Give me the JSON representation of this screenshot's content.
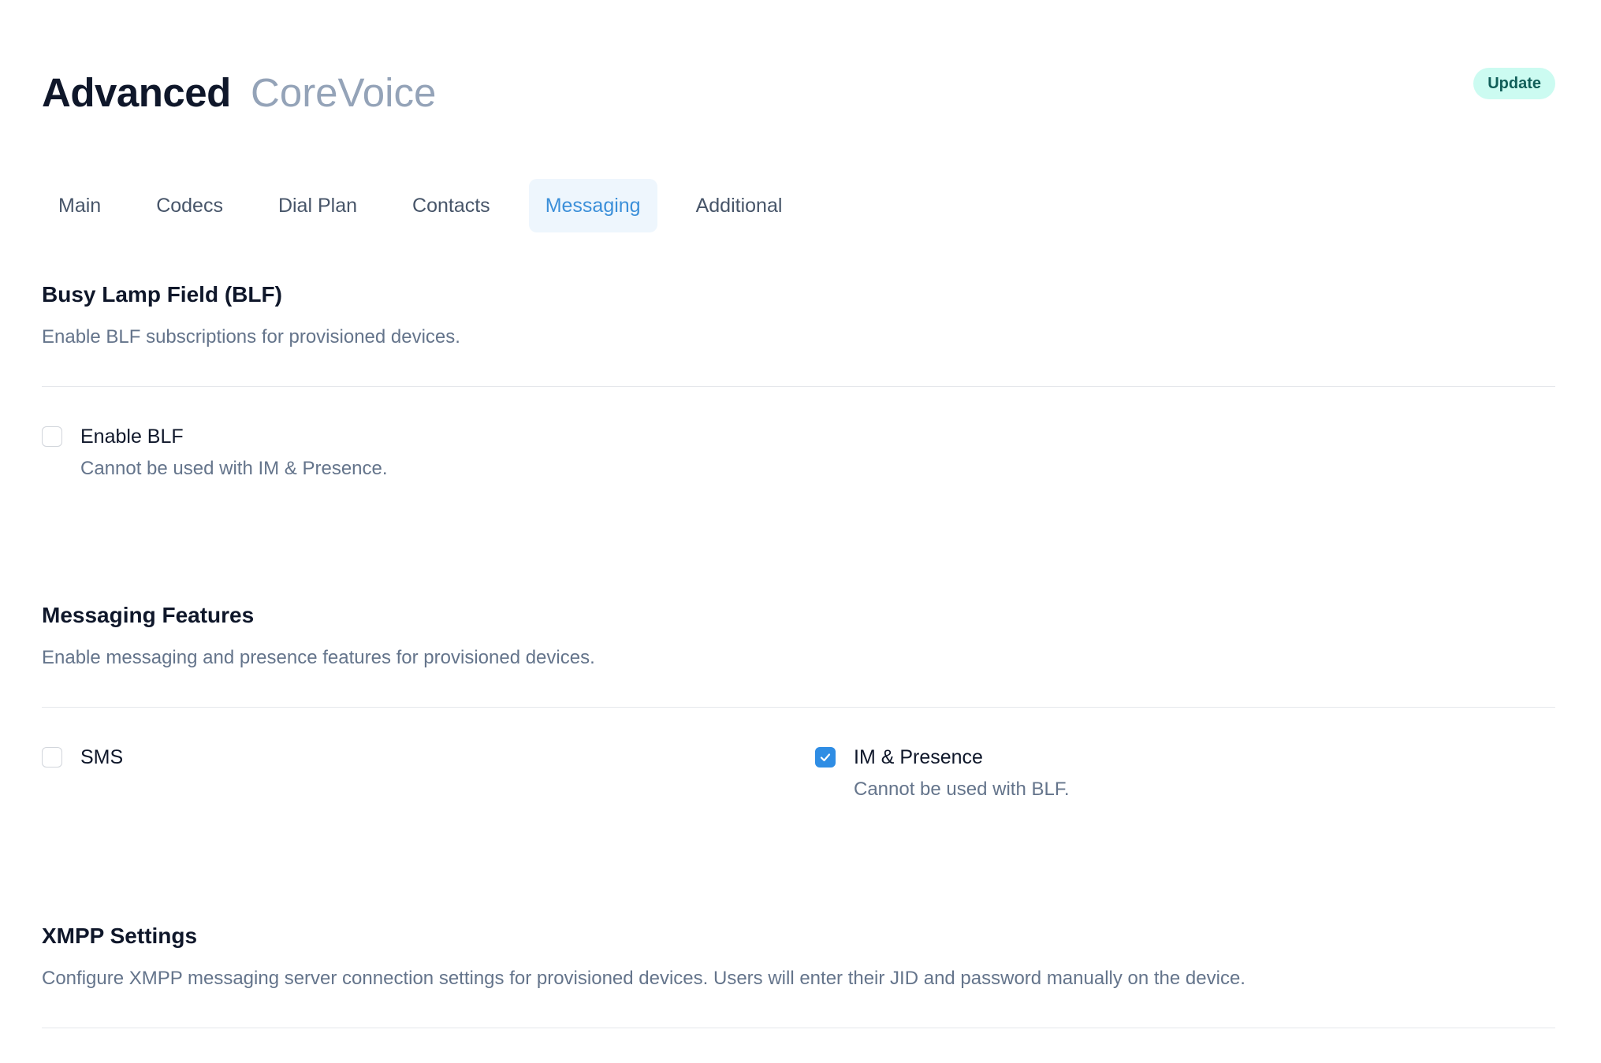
{
  "header": {
    "title": "Advanced",
    "subtitle": "CoreVoice",
    "update_label": "Update",
    "badge_color": "#ccfbf1"
  },
  "tabs": [
    {
      "label": "Main",
      "active": false
    },
    {
      "label": "Codecs",
      "active": false
    },
    {
      "label": "Dial Plan",
      "active": false
    },
    {
      "label": "Contacts",
      "active": false
    },
    {
      "label": "Messaging",
      "active": true
    },
    {
      "label": "Additional",
      "active": false
    }
  ],
  "accent_color": "#2f8de4",
  "blf": {
    "title": "Busy Lamp Field (BLF)",
    "description": "Enable BLF subscriptions for provisioned devices.",
    "enable_blf": {
      "label": "Enable BLF",
      "help": "Cannot be used with IM & Presence.",
      "checked": false
    }
  },
  "messaging": {
    "title": "Messaging Features",
    "description": "Enable messaging and presence features for provisioned devices.",
    "sms": {
      "label": "SMS",
      "checked": false
    },
    "im_presence": {
      "label": "IM & Presence",
      "help": "Cannot be used with BLF.",
      "checked": true,
      "icon": "check-icon"
    }
  },
  "xmpp": {
    "title": "XMPP Settings",
    "description": "Configure XMPP messaging server connection settings for provisioned devices. Users will enter their JID and password manually on the device."
  }
}
